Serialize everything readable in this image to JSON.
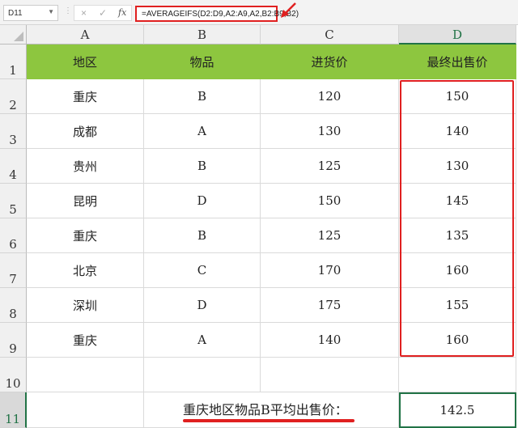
{
  "formula_bar": {
    "name_box": "D11",
    "cancel_icon": "×",
    "enter_icon": "✓",
    "fx_label": "fx",
    "formula": "=AVERAGEIFS(D2:D9,A2:A9,A2,B2:B9,B2)"
  },
  "columns": [
    "A",
    "B",
    "C",
    "D"
  ],
  "rows": [
    "1",
    "2",
    "3",
    "4",
    "5",
    "6",
    "7",
    "8",
    "9",
    "10",
    "11"
  ],
  "header": [
    "地区",
    "物品",
    "进货价",
    "最终出售价"
  ],
  "data": [
    [
      "重庆",
      "B",
      "120",
      "150"
    ],
    [
      "成都",
      "A",
      "130",
      "140"
    ],
    [
      "贵州",
      "B",
      "125",
      "130"
    ],
    [
      "昆明",
      "D",
      "150",
      "145"
    ],
    [
      "重庆",
      "B",
      "125",
      "135"
    ],
    [
      "北京",
      "C",
      "170",
      "160"
    ],
    [
      "深圳",
      "D",
      "175",
      "155"
    ],
    [
      "重庆",
      "A",
      "140",
      "160"
    ]
  ],
  "summary": {
    "label": "重庆地区物品B平均出售价：",
    "value": "142.5"
  },
  "colors": {
    "header_fill": "#8dc63f",
    "highlight": "#e02020",
    "selection": "#217346"
  }
}
